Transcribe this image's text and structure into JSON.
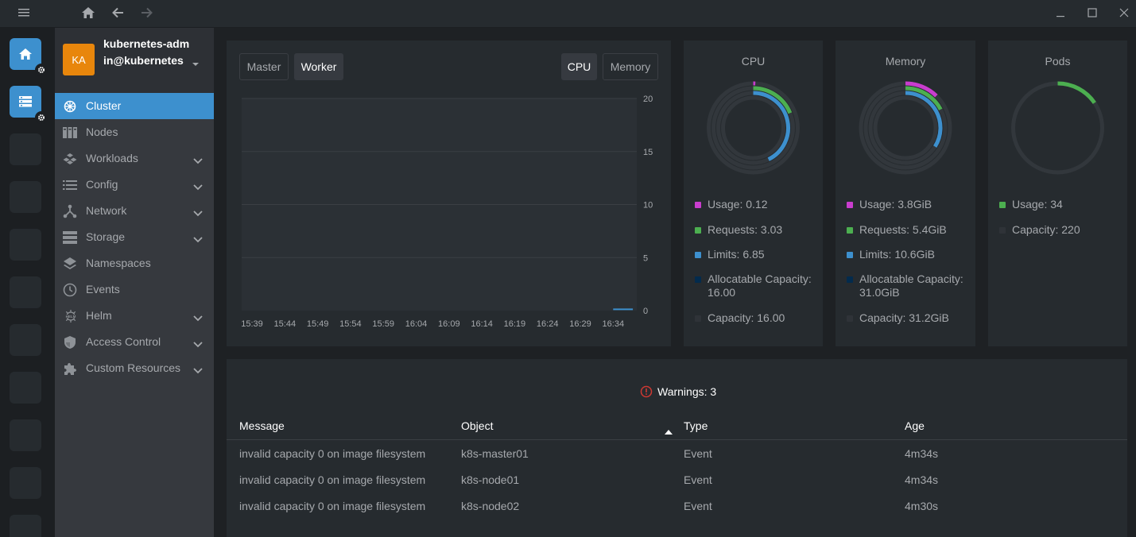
{
  "window": {
    "menu_icon": "hamburger-icon",
    "home_icon": "home-icon",
    "back_icon": "arrow-left-icon",
    "forward_icon": "arrow-right-icon",
    "minimize_icon": "minimize-icon",
    "maximize_icon": "maximize-icon",
    "close_icon": "close-icon"
  },
  "cluster": {
    "avatar": "KA",
    "name": "kubernetes-admin@kubernetes",
    "avatar_color": "#e8860c"
  },
  "sidebar": {
    "items": [
      {
        "label": "Cluster",
        "icon": "kubernetes-wheel-icon",
        "active": true
      },
      {
        "label": "Nodes",
        "icon": "nodes-icon"
      },
      {
        "label": "Workloads",
        "icon": "workloads-icon",
        "expandable": true
      },
      {
        "label": "Config",
        "icon": "config-list-icon",
        "expandable": true
      },
      {
        "label": "Network",
        "icon": "network-icon",
        "expandable": true
      },
      {
        "label": "Storage",
        "icon": "storage-icon",
        "expandable": true
      },
      {
        "label": "Namespaces",
        "icon": "layers-icon"
      },
      {
        "label": "Events",
        "icon": "clock-icon"
      },
      {
        "label": "Helm",
        "icon": "helm-icon",
        "expandable": true
      },
      {
        "label": "Access Control",
        "icon": "shield-icon",
        "expandable": true
      },
      {
        "label": "Custom Resources",
        "icon": "puzzle-icon",
        "expandable": true
      }
    ]
  },
  "metrics_chart": {
    "node_tabs": [
      "Master",
      "Worker"
    ],
    "active_node_tab": "Worker",
    "metric_tabs": [
      "CPU",
      "Memory"
    ],
    "active_metric_tab": "CPU"
  },
  "chart_data": {
    "type": "line",
    "title": "",
    "xlabel": "",
    "ylabel": "",
    "x": [
      "15:39",
      "15:44",
      "15:49",
      "15:54",
      "15:59",
      "16:04",
      "16:09",
      "16:14",
      "16:19",
      "16:24",
      "16:29",
      "16:34"
    ],
    "y_ticks": [
      0,
      5,
      10,
      15,
      20
    ],
    "ylim": [
      0,
      20
    ],
    "y_axis_position": "right",
    "grid": true,
    "series": [
      {
        "x": [
          "16:34",
          "16:37"
        ],
        "values": [
          0.12,
          0.12
        ],
        "color": "#3d90ce"
      }
    ]
  },
  "cpu": {
    "title": "CPU",
    "legend": [
      {
        "label": "Usage: 0.12",
        "color": "#c93dce"
      },
      {
        "label": "Requests: 3.03",
        "color": "#4caf50"
      },
      {
        "label": "Limits: 6.85",
        "color": "#3d90ce"
      },
      {
        "label": "Allocatable Capacity: 16.00",
        "color": "#032b4d"
      },
      {
        "label": "Capacity: 16.00",
        "color": "#2f3338"
      }
    ],
    "rings": [
      0.0075,
      0.189,
      0.428
    ]
  },
  "memory": {
    "title": "Memory",
    "legend": [
      {
        "label": "Usage: 3.8GiB",
        "color": "#c93dce"
      },
      {
        "label": "Requests: 5.4GiB",
        "color": "#4caf50"
      },
      {
        "label": "Limits: 10.6GiB",
        "color": "#3d90ce"
      },
      {
        "label": "Allocatable Capacity: 31.0GiB",
        "color": "#032b4d"
      },
      {
        "label": "Capacity: 31.2GiB",
        "color": "#2f3338"
      }
    ],
    "rings": [
      0.122,
      0.173,
      0.34
    ]
  },
  "pods": {
    "title": "Pods",
    "legend": [
      {
        "label": "Usage: 34",
        "color": "#4caf50"
      },
      {
        "label": "Capacity: 220",
        "color": "#2f3338"
      }
    ],
    "fraction": 0.155
  },
  "warnings": {
    "icon": "error-circle-icon",
    "title": "Warnings: 3",
    "columns": [
      "Message",
      "Object",
      "Type",
      "Age"
    ],
    "sort_icon": "sort-asc-icon",
    "rows": [
      {
        "message": "invalid capacity 0 on image filesystem",
        "object": "k8s-master01",
        "type": "Event",
        "age": "4m34s"
      },
      {
        "message": "invalid capacity 0 on image filesystem",
        "object": "k8s-node01",
        "type": "Event",
        "age": "4m34s"
      },
      {
        "message": "invalid capacity 0 on image filesystem",
        "object": "k8s-node02",
        "type": "Event",
        "age": "4m30s"
      }
    ]
  }
}
